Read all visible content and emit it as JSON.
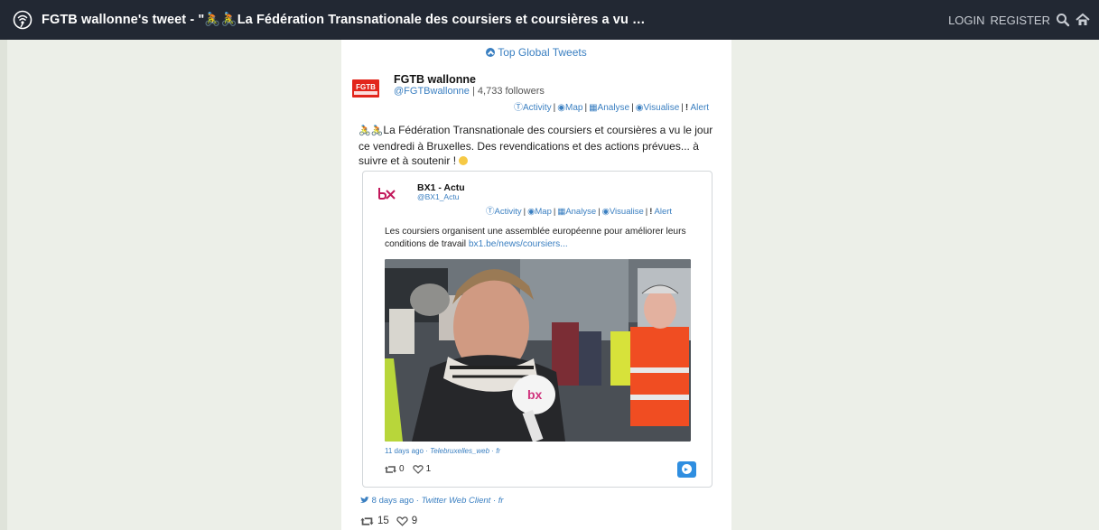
{
  "header": {
    "title": "FGTB wallonne's tweet - \"🚴🚴La Fédération Transnationale des coursiers et coursières a vu …",
    "login": "LOGIN",
    "register": "REGISTER",
    "icons": [
      "search-icon",
      "home-icon"
    ]
  },
  "top_link": "Top Global Tweets",
  "tweet": {
    "avatar_text": "FGTB",
    "name": "FGTB wallonne",
    "handle": "@FGTBwallonne",
    "followers": "4,733 followers",
    "actions": {
      "activity": "Activity",
      "map": "Map",
      "analyse": "Analyse",
      "visualise": "Visualise",
      "alert": "Alert"
    },
    "text": "La Fédération Transnationale des coursiers et coursières a vu le jour ce vendredi à Bruxelles. Des revendications et des actions prévues... à suivre et à soutenir !",
    "time": "8 days ago",
    "client": "Twitter Web Client",
    "lang": "fr",
    "retweets": "15",
    "likes": "9"
  },
  "quoted": {
    "name": "BX1 - Actu",
    "handle": "@BX1_Actu",
    "actions": {
      "activity": "Activity",
      "map": "Map",
      "analyse": "Analyse",
      "visualise": "Visualise",
      "alert": "Alert"
    },
    "text": "Les coursiers organisent une assemblée européenne pour améliorer leurs conditions de travail",
    "link": "bx1.be/news/coursiers...",
    "time": "11 days ago",
    "client": "Telebruxelles_web",
    "lang": "fr",
    "retweets": "0",
    "likes": "1"
  },
  "colors": {
    "topbar": "#222833",
    "background": "#ecefe8",
    "link": "#3a7fc1",
    "button": "#2f8ee0",
    "fgtb_red": "#e2261c"
  }
}
